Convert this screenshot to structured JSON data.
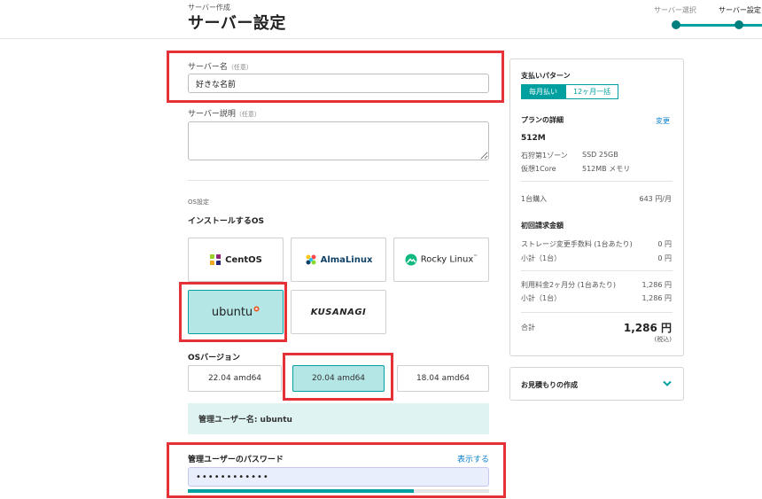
{
  "header": {
    "kicker": "サーバー作成",
    "title": "サーバー設定",
    "steps": [
      "サーバー選択",
      "サーバー設定"
    ]
  },
  "form": {
    "server_name": {
      "label": "サーバー名",
      "optional": "（任意）",
      "value": "好きな名前"
    },
    "server_desc": {
      "label": "サーバー説明",
      "optional": "（任意）",
      "value": ""
    },
    "os_section": "OS設定",
    "install_os": "インストールするOS",
    "os_options": [
      {
        "name": "CentOS",
        "icon": "centos-icon",
        "selected": false
      },
      {
        "name": "AlmaLinux",
        "icon": "almalinux-icon",
        "selected": false
      },
      {
        "name": "Rocky Linux",
        "icon": "rockylinux-icon",
        "selected": false
      },
      {
        "name": "ubuntu",
        "icon": "ubuntu-icon",
        "selected": true
      },
      {
        "name": "KUSANAGI",
        "icon": "kusanagi-icon",
        "selected": false
      }
    ],
    "rocky_tm": "™",
    "os_version_label": "OSバージョン",
    "os_versions": [
      {
        "label": "22.04 amd64",
        "selected": false
      },
      {
        "label": "20.04 amd64",
        "selected": true
      },
      {
        "label": "18.04 amd64",
        "selected": false
      }
    ],
    "admin_user": "管理ユーザー名: ubuntu",
    "password": {
      "label": "管理ユーザーのパスワード",
      "show_label": "表示する",
      "value": "••••••••••••",
      "strength": 0.75
    }
  },
  "summary": {
    "payment_pattern_label": "支払いパターン",
    "payment_options": [
      {
        "label": "毎月払い",
        "active": true
      },
      {
        "label": "12ヶ月一括",
        "active": false
      }
    ],
    "plan_details_label": "プランの詳細",
    "change_label": "変更",
    "plan_name": "512M",
    "zone": "石狩第1ゾーン",
    "storage": "SSD 25GB",
    "cpu": "仮想1Core",
    "memory": "512MB メモリ",
    "purchase_label": "1台購入",
    "purchase_price": "643 円/月",
    "initial_label": "初回請求金額",
    "storage_fee_label": "ストレージ変更手数料 (1台あたり)",
    "storage_fee_value": "0 円",
    "subtotal1_label": "小計（1台）",
    "subtotal1_value": "0 円",
    "usage_label": "利用料金2ヶ月分 (1台あたり)",
    "usage_value": "1,286 円",
    "subtotal2_label": "小計（1台）",
    "subtotal2_value": "1,286 円",
    "total_label": "合計",
    "total_value": "1,286 円",
    "tax_note": "(税込)"
  },
  "estimate": {
    "label": "お見積もりの作成",
    "icon": "chevron-down-icon"
  },
  "colors": {
    "accent": "#00a0a0",
    "selected_bg": "#b4e6e6",
    "highlight_red": "#e53238",
    "link": "#0a7fcc"
  }
}
